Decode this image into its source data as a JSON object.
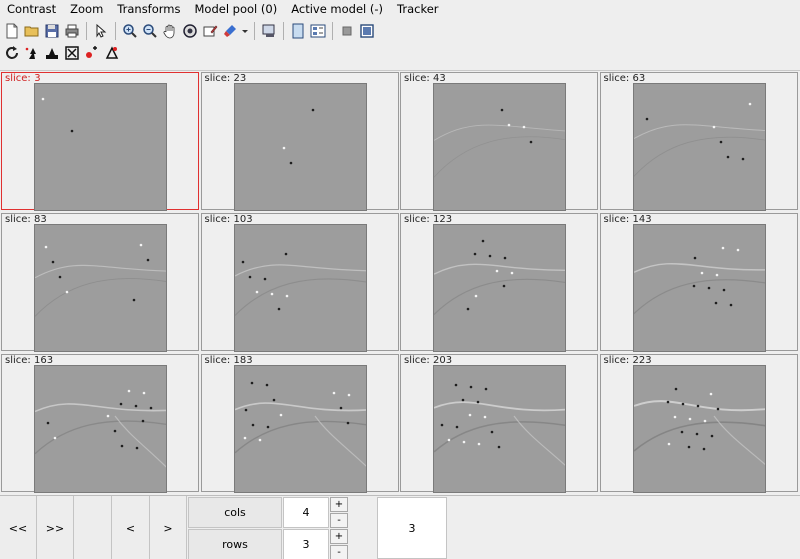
{
  "menu": [
    "Contrast",
    "Zoom",
    "Transforms",
    "Model pool (0)",
    "Active model (-)",
    "Tracker"
  ],
  "toolbar1_icons": [
    "new-file-icon",
    "open-folder-icon",
    "save-icon",
    "print-icon",
    "pointer-icon",
    "zoom-in-icon",
    "zoom-out-icon",
    "pan-hand-icon",
    "rotate-icon",
    "annotate-icon",
    "brush-icon",
    "dropdown-arrow-icon",
    "export-window-icon",
    "single-view-icon",
    "grid-view-icon",
    "stop-icon",
    "fullscreen-icon"
  ],
  "toolbar2_icons": [
    "refresh-icon",
    "tracker-a-icon",
    "tracker-b-icon",
    "fit-icon",
    "marker-icon",
    "reset-marker-icon"
  ],
  "slices": [
    {
      "label": "slice:",
      "value": "3",
      "active": true
    },
    {
      "label": "slice:",
      "value": "23",
      "active": false
    },
    {
      "label": "slice:",
      "value": "43",
      "active": false
    },
    {
      "label": "slice:",
      "value": "63",
      "active": false
    },
    {
      "label": "slice:",
      "value": "83",
      "active": false
    },
    {
      "label": "slice:",
      "value": "103",
      "active": false
    },
    {
      "label": "slice:",
      "value": "123",
      "active": false
    },
    {
      "label": "slice:",
      "value": "143",
      "active": false
    },
    {
      "label": "slice:",
      "value": "163",
      "active": false
    },
    {
      "label": "slice:",
      "value": "183",
      "active": false
    },
    {
      "label": "slice:",
      "value": "203",
      "active": false
    },
    {
      "label": "slice:",
      "value": "223",
      "active": false
    }
  ],
  "bottom": {
    "first_label": "<<",
    "last_label": ">>",
    "prev_label": "<",
    "next_label": ">",
    "cols_label": "cols",
    "cols_value": "4",
    "rows_label": "rows",
    "rows_value": "3",
    "plus_label": "+",
    "minus_label": "-",
    "current_slice": "3"
  },
  "colors": {
    "active_border": "#e03030",
    "image_gray": "#9d9d9d"
  }
}
